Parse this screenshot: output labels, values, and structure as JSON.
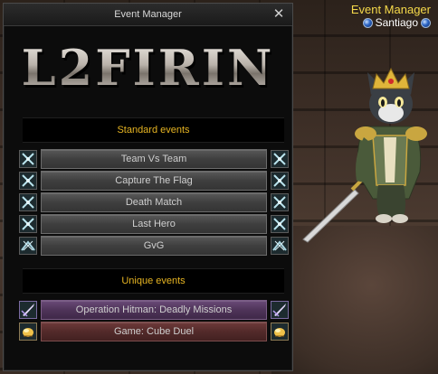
{
  "window": {
    "title": "Event Manager",
    "close_label": "✕",
    "logo_text": "L2FIRIN"
  },
  "npc": {
    "title": "Event Manager",
    "name": "Santiago"
  },
  "standard": {
    "header": "Standard events",
    "events": [
      {
        "label": "Team Vs Team",
        "icon": "crossed-swords-icon"
      },
      {
        "label": "Capture The Flag",
        "icon": "crossed-swords-icon"
      },
      {
        "label": "Death Match",
        "icon": "crossed-swords-icon"
      },
      {
        "label": "Last Hero",
        "icon": "crossed-swords-icon"
      },
      {
        "label": "GvG",
        "icon": "clan-war-icon"
      }
    ]
  },
  "unique": {
    "header": "Unique events",
    "events": [
      {
        "label": "Operation Hitman: Deadly Missions",
        "icon": "dagger-strike-icon"
      },
      {
        "label": "Game: Cube Duel",
        "icon": "gold-cube-icon"
      }
    ]
  },
  "colors": {
    "header_text": "#e6b422",
    "npc_title": "#f5d94a"
  }
}
